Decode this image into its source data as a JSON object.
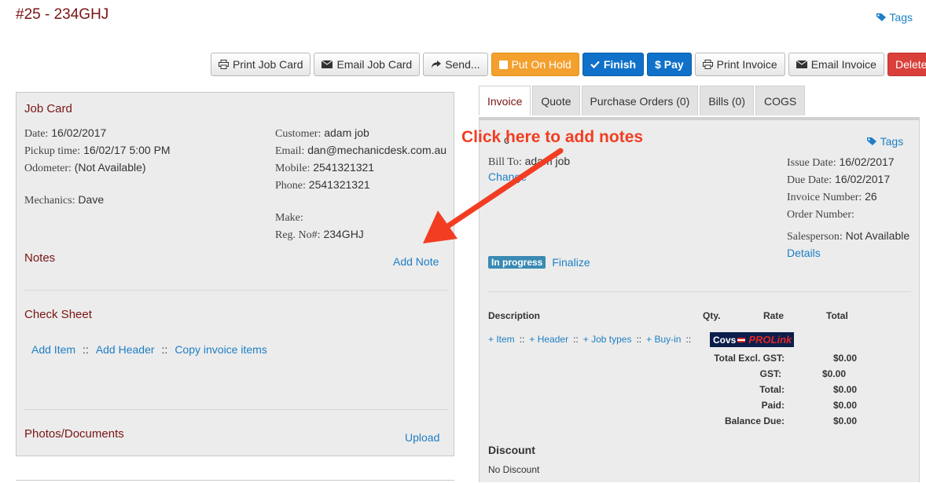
{
  "page": {
    "title": "#25 - 234GHJ",
    "tags_label": "Tags"
  },
  "toolbar": {
    "print_job_card": "Print Job Card",
    "email_job_card": "Email Job Card",
    "send": "Send...",
    "put_on_hold": "Put On Hold",
    "finish": "Finish",
    "pay": "$ Pay",
    "print_invoice": "Print Invoice",
    "email_invoice": "Email Invoice",
    "delete": "Delete"
  },
  "job_card": {
    "heading": "Job Card",
    "date_label": "Date:",
    "date": "16/02/2017",
    "pickup_label": "Pickup time:",
    "pickup": "16/02/17 5:00 PM",
    "odometer_label": "Odometer:",
    "odometer": "(Not Available)",
    "mechanics_label": "Mechanics:",
    "mechanics": "Dave",
    "customer_label": "Customer:",
    "customer": "adam job",
    "email_label": "Email:",
    "email": "dan@mechanicdesk.com.au",
    "mobile_label": "Mobile:",
    "mobile": "2541321321",
    "phone_label": "Phone:",
    "phone": "2541321321",
    "make_label": "Make:",
    "make": "",
    "reg_label": "Reg. No#:",
    "reg": "234GHJ",
    "notes_heading": "Notes",
    "add_note": "Add Note",
    "check_sheet_heading": "Check Sheet",
    "add_item": "Add Item",
    "sep": "::",
    "add_header": "Add Header",
    "copy_items": "Copy invoice items",
    "photos_heading": "Photos/Documents",
    "upload": "Upload"
  },
  "tabs": [
    {
      "label": "Invoice",
      "active": true
    },
    {
      "label": "Quote"
    },
    {
      "label": "Purchase Orders (0)"
    },
    {
      "label": "Bills (0)"
    },
    {
      "label": "COGS"
    }
  ],
  "invoice": {
    "tags_label": "Tags",
    "bill_to_label": "Bill To:",
    "bill_to": "adam job",
    "change_link": "Change",
    "partial_char": "c",
    "issue_date_label": "Issue Date:",
    "issue_date": "16/02/2017",
    "due_date_label": "Due Date:",
    "due_date": "16/02/2017",
    "invoice_number_label": "Invoice Number:",
    "invoice_number": "26",
    "order_number_label": "Order Number:",
    "order_number": "",
    "salesperson_label": "Salesperson:",
    "salesperson": "Not Available",
    "details_link": "Details",
    "status_badge": "In progress",
    "finalize_link": "Finalize",
    "columns": {
      "description": "Description",
      "qty": "Qty.",
      "rate": "Rate",
      "total": "Total"
    },
    "add_item": "+ Item",
    "add_header": "+ Header",
    "add_job_types": "+ Job types",
    "add_buy_in": "+ Buy-in",
    "sep": "::",
    "logo_left": "Covs",
    "logo_right": "PROLink",
    "totals": [
      {
        "label": "Total Excl. GST:",
        "value": "$0.00"
      },
      {
        "label": "GST:",
        "value": "$0.00"
      },
      {
        "label": "Total:",
        "value": "$0.00"
      },
      {
        "label": "Paid:",
        "value": "$0.00"
      },
      {
        "label": "Balance Due:",
        "value": "$0.00"
      }
    ],
    "discount_heading": "Discount",
    "discount_value": "No Discount"
  },
  "annotation": {
    "text": "Click here to add notes",
    "color": "#f23d22"
  }
}
